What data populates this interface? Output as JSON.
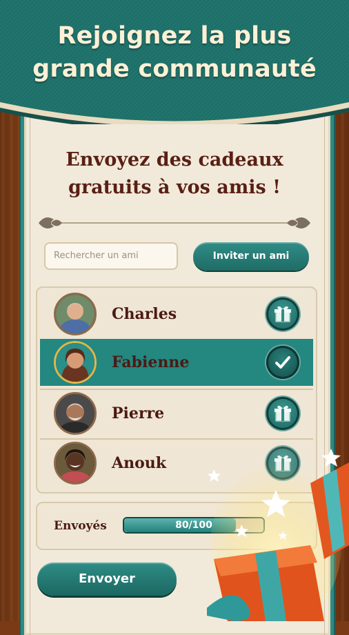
{
  "header": {
    "headline_line1": "Rejoignez la plus",
    "headline_line2": "grande communauté"
  },
  "panel": {
    "subtitle_line1": "Envoyez des cadeaux",
    "subtitle_line2": "gratuits à vos amis !"
  },
  "search": {
    "placeholder": "Rechercher un ami"
  },
  "invite": {
    "label": "Inviter un ami"
  },
  "friends": [
    {
      "name": "Charles",
      "status": "gift",
      "icon": "gift-icon"
    },
    {
      "name": "Fabienne",
      "status": "sent",
      "icon": "check-icon"
    },
    {
      "name": "Pierre",
      "status": "gift",
      "icon": "gift-icon"
    },
    {
      "name": "Anouk",
      "status": "gift",
      "icon": "gift-icon"
    }
  ],
  "progress": {
    "label": "Envoyés",
    "text": "80/100",
    "value": 80,
    "max": 100
  },
  "send": {
    "label": "Envoyer"
  },
  "colors": {
    "teal": "#248780",
    "teal_dark": "#1c6761",
    "parchment": "#f1eadb",
    "name_text": "#4b1a12",
    "headline_text": "#fbf1d6"
  }
}
